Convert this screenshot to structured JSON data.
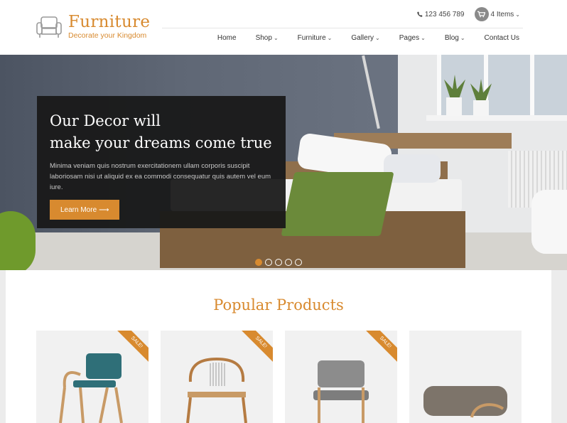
{
  "brand": {
    "name": "Furniture",
    "tagline": "Decorate your Kingdom"
  },
  "topbar": {
    "phone": "123 456 789",
    "cart": "4 Items"
  },
  "nav": {
    "items": [
      {
        "label": "Home",
        "dropdown": false
      },
      {
        "label": "Shop",
        "dropdown": true
      },
      {
        "label": "Furniture",
        "dropdown": true
      },
      {
        "label": "Gallery",
        "dropdown": true
      },
      {
        "label": "Pages",
        "dropdown": true
      },
      {
        "label": "Blog",
        "dropdown": true
      },
      {
        "label": "Contact Us",
        "dropdown": false
      }
    ]
  },
  "hero": {
    "title_line1": "Our Decor will",
    "title_line2": "make your dreams come true",
    "text": "Minima veniam quis nostrum exercitationem ullam corporis suscipit laboriosam nisi ut aliquid ex ea commodi consequatur quis autem vel eum iure.",
    "button": "Learn More",
    "slides": 5,
    "active_slide": 1
  },
  "products": {
    "title": "Popular Products",
    "items": [
      {
        "name": "teal-armchair",
        "sale": "SALE!"
      },
      {
        "name": "wire-back-chair",
        "sale": "SALE!"
      },
      {
        "name": "grey-chair",
        "sale": "SALE!"
      },
      {
        "name": "footstool",
        "sale": ""
      }
    ]
  },
  "colors": {
    "accent": "#d88a2f",
    "hero_box": "#181818"
  }
}
